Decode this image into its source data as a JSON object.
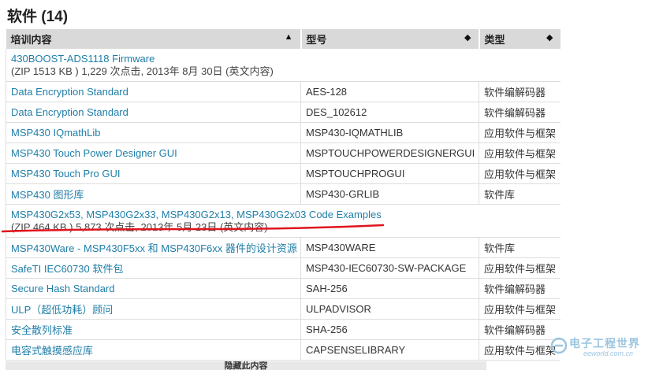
{
  "section": {
    "title": "软件 (14)"
  },
  "table": {
    "headers": [
      {
        "label": "培训内容",
        "sort_icon": "sort-up-icon"
      },
      {
        "label": "型号",
        "sort_icon": "sort-both-icon"
      },
      {
        "label": "类型",
        "sort_icon": "sort-both-icon"
      }
    ],
    "rows": [
      {
        "title": "430BOOST-ADS1118 Firmware",
        "meta": "(ZIP 1513 KB )    1,229 次点击, 2013年 8月 30日    (英文内容)",
        "model": "",
        "type": "",
        "merged": true
      },
      {
        "title": "Data Encryption Standard",
        "model": "AES-128",
        "type": "软件编解码器"
      },
      {
        "title": "Data Encryption Standard",
        "model": "DES_102612",
        "type": "软件编解码器"
      },
      {
        "title": "MSP430 IQmathLib",
        "model": "MSP430-IQMATHLIB",
        "type": "应用软件与框架"
      },
      {
        "title": "MSP430 Touch Power Designer GUI",
        "model": "MSPTOUCHPOWERDESIGNERGUI",
        "type": "应用软件与框架"
      },
      {
        "title": "MSP430 Touch Pro GUI",
        "model": "MSPTOUCHPROGUI",
        "type": "应用软件与框架"
      },
      {
        "title": "MSP430 图形库",
        "model": "MSP430-GRLIB",
        "type": "软件库"
      },
      {
        "title": "MSP430G2x53, MSP430G2x33, MSP430G2x13, MSP430G2x03 Code Examples",
        "meta": "(ZIP 464 KB )    5,873 次点击, 2013年 5月 23日    (英文内容)",
        "model": "",
        "type": "",
        "merged": true
      },
      {
        "title": "MSP430Ware - MSP430F5xx 和 MSP430F6xx 器件的设计资源",
        "model": "MSP430WARE",
        "type": "软件库"
      },
      {
        "title": "SafeTI IEC60730 软件包",
        "model": "MSP430-IEC60730-SW-PACKAGE",
        "type": "应用软件与框架"
      },
      {
        "title": "Secure Hash Standard",
        "model": "SAH-256",
        "type": "软件编解码器"
      },
      {
        "title": "ULP（超低功耗）顾问",
        "model": "ULPADVISOR",
        "type": "应用软件与框架"
      },
      {
        "title": "安全散列标准",
        "model": "SHA-256",
        "type": "软件编解码器"
      },
      {
        "title": "电容式触摸感应库",
        "model": "CAPSENSELIBRARY",
        "type": "应用软件与框架"
      }
    ]
  },
  "footer": {
    "hide_label": "隐藏此内容"
  },
  "watermark": {
    "main": "电子工程世界",
    "sub": "eeworld.com.cn"
  },
  "annotation": {
    "underline_color": "#e0141e"
  }
}
